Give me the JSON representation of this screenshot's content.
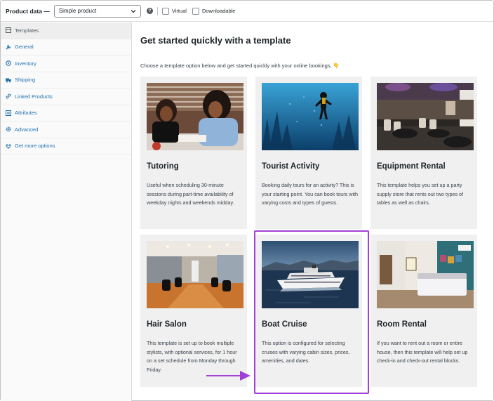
{
  "header": {
    "title": "Product data —",
    "product_type": "Simple product",
    "help_icon": "?",
    "virtual_label": "Virtual",
    "downloadable_label": "Downloadable"
  },
  "sidebar": {
    "items": [
      {
        "label": "Templates",
        "icon": "templates-icon"
      },
      {
        "label": "General",
        "icon": "wrench-icon"
      },
      {
        "label": "Inventory",
        "icon": "inventory-icon"
      },
      {
        "label": "Shipping",
        "icon": "truck-icon"
      },
      {
        "label": "Linked Products",
        "icon": "link-icon"
      },
      {
        "label": "Attributes",
        "icon": "list-icon"
      },
      {
        "label": "Advanced",
        "icon": "gear-icon"
      },
      {
        "label": "Get more options",
        "icon": "plugin-icon"
      }
    ]
  },
  "main": {
    "heading": "Get started quickly with a template",
    "subheading": "Choose a template option below and get started quickly with your online bookings. 👇",
    "cards": [
      {
        "title": "Tutoring",
        "description": "Useful when scheduling 30-minute sessions during part-time availability of weekday nights and weekends midday.",
        "image": "tutoring-photo"
      },
      {
        "title": "Tourist Activity",
        "description": "Booking daily tours for an activity? This is your starting point. You can book tours with varying costs and types of guests.",
        "image": "diver-photo"
      },
      {
        "title": "Equipment Rental",
        "description": "This template helps you set up a party supply store that rents out two types of tables as well as chairs.",
        "image": "party-hall-photo"
      },
      {
        "title": "Hair Salon",
        "description": "This template is set up to book multiple stylists, with optional services, for 1 hour on a set schedule from Monday through Friday.",
        "image": "salon-photo"
      },
      {
        "title": "Boat Cruise",
        "description": "This option is configured for selecting cruises with varying cabin sizes, prices, amenities, and dates.",
        "image": "cruise-ship-photo"
      },
      {
        "title": "Room Rental",
        "description": "If you want to rent out a room or entire house, then this template will help set up check-in and check-out rental blocks.",
        "image": "bedroom-photo"
      }
    ]
  },
  "annotation": {
    "highlight_color": "#a23fd6",
    "arrow_color": "#a23fd6"
  },
  "colors": {
    "link": "#2271b1",
    "card_bg": "#f0f0f0"
  }
}
